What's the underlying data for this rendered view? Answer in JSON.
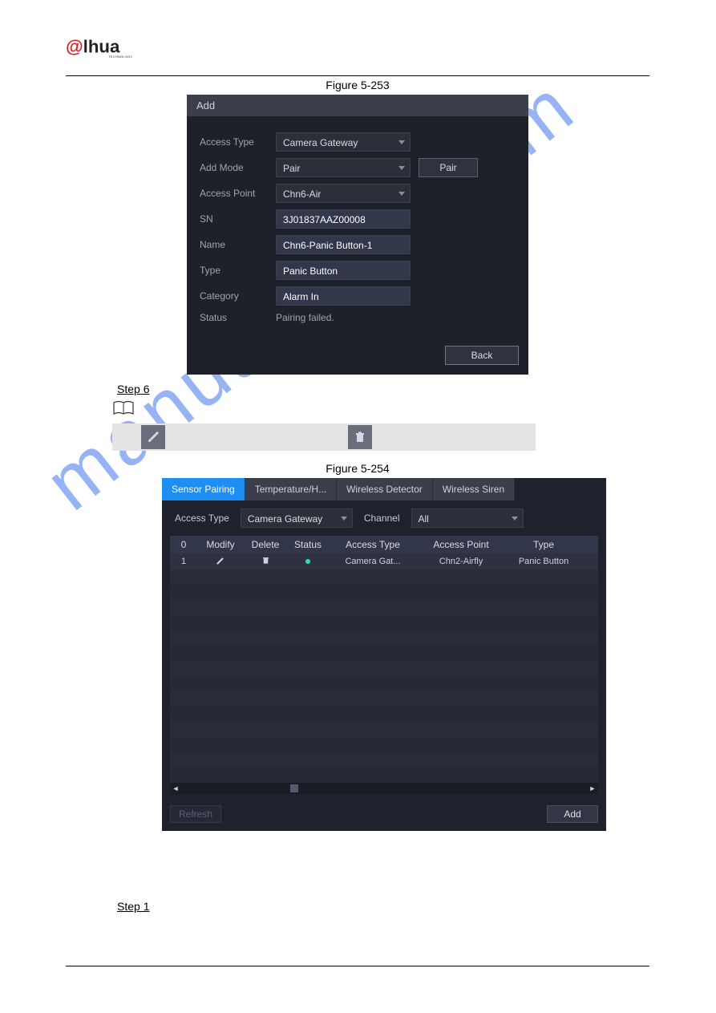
{
  "logo": {
    "brand_prefix": "a",
    "brand_suffix": "hua",
    "tagline": "TECHNOLOGY"
  },
  "watermark": "manualslive.com",
  "fig253_caption": "Figure 5-253",
  "fig254_caption": "Figure 5-254",
  "step6_label": "Step 6",
  "step1_label": "Step 1",
  "icons": {
    "book": "book-icon",
    "edit": "pencil-icon",
    "delete": "trash-icon"
  },
  "panel1": {
    "title": "Add",
    "rows": {
      "access_type": {
        "label": "Access Type",
        "value": "Camera Gateway"
      },
      "add_mode": {
        "label": "Add Mode",
        "value": "Pair",
        "button": "Pair"
      },
      "access_point": {
        "label": "Access Point",
        "value": "Chn6-Air"
      },
      "sn": {
        "label": "SN",
        "value": "3J01837AAZ00008"
      },
      "name": {
        "label": "Name",
        "value": "Chn6-Panic Button-1"
      },
      "type": {
        "label": "Type",
        "value": "Panic Button"
      },
      "category": {
        "label": "Category",
        "value": "Alarm In"
      },
      "status": {
        "label": "Status",
        "value": "Pairing failed."
      }
    },
    "back_button": "Back"
  },
  "panel2": {
    "tabs": [
      "Sensor Pairing",
      "Temperature/H...",
      "Wireless Detector",
      "Wireless Siren"
    ],
    "active_tab": 0,
    "filters": {
      "access_type_label": "Access Type",
      "access_type_value": "Camera Gateway",
      "channel_label": "Channel",
      "channel_value": "All"
    },
    "columns": [
      "0",
      "Modify",
      "Delete",
      "Status",
      "Access Type",
      "Access Point",
      "Type"
    ],
    "rows": [
      {
        "idx": "1",
        "access_type": "Camera Gat...",
        "access_point": "Chn2-Airfly",
        "type": "Panic Button"
      }
    ],
    "refresh_button": "Refresh",
    "add_button": "Add"
  }
}
